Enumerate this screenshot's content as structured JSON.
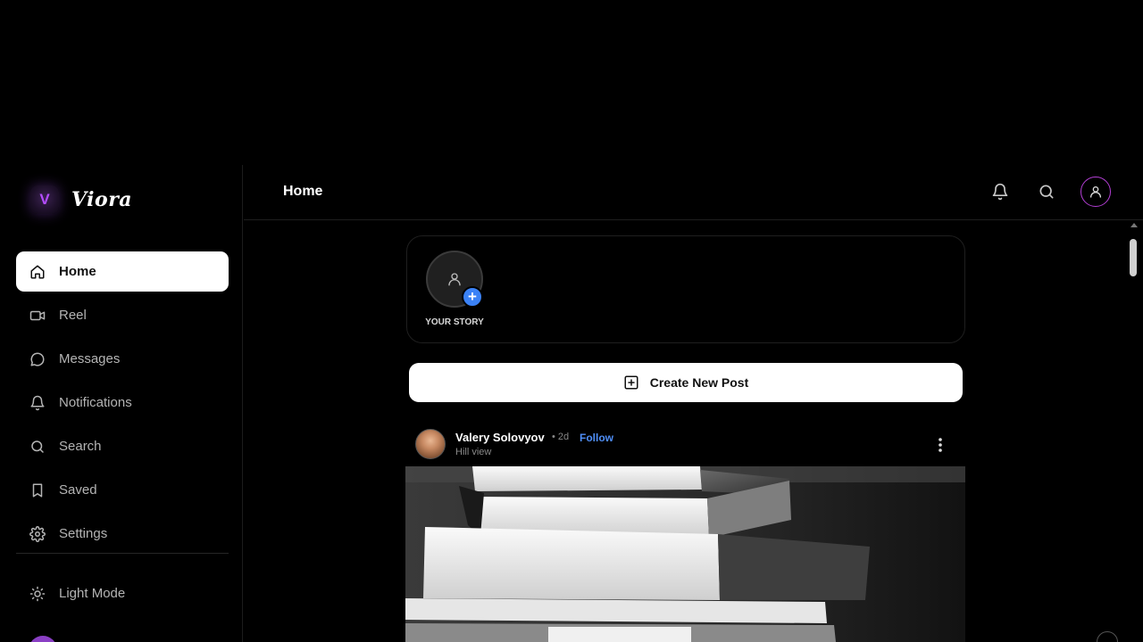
{
  "brand": {
    "logo_letter": "V",
    "name": "Viora"
  },
  "sidebar": {
    "items": [
      {
        "label": "Home",
        "icon": "home-icon",
        "active": true
      },
      {
        "label": "Reel",
        "icon": "video-icon"
      },
      {
        "label": "Messages",
        "icon": "message-icon"
      },
      {
        "label": "Notifications",
        "icon": "bell-icon"
      },
      {
        "label": "Search",
        "icon": "search-icon"
      },
      {
        "label": "Saved",
        "icon": "bookmark-icon"
      },
      {
        "label": "Settings",
        "icon": "gear-icon"
      }
    ],
    "theme_toggle": {
      "label": "Light Mode",
      "icon": "sun-icon"
    }
  },
  "header": {
    "title": "Home"
  },
  "stories": {
    "your_story_label": "YOUR STORY",
    "add_symbol": "+"
  },
  "create_post": {
    "label": "Create New Post",
    "icon": "plus-square-icon"
  },
  "post": {
    "author": "Valery Solovyov",
    "separator_time": "• 2d",
    "follow_label": "Follow",
    "location": "Hill view"
  },
  "colors": {
    "background": "#000000",
    "accent_purple": "#b43fd6",
    "follow_blue": "#4f8ef7",
    "story_add_blue": "#3b82f6"
  }
}
